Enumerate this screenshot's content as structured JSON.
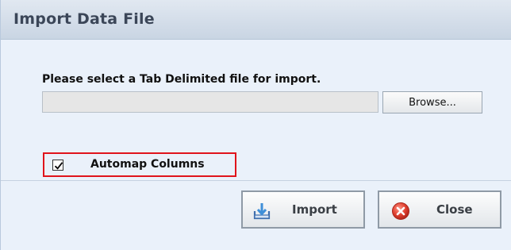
{
  "dialog": {
    "title": "Import Data File",
    "prompt": "Please select a Tab Delimited file for import.",
    "file_input": {
      "value": "",
      "placeholder": ""
    },
    "browse_label": "Browse...",
    "automap": {
      "label": "Automap Columns",
      "checked": true
    },
    "buttons": {
      "import_label": "Import",
      "close_label": "Close"
    },
    "icons": {
      "import": "import-download-icon",
      "close": "close-x-circle-icon"
    },
    "colors": {
      "title_bar": "#c9d5e3",
      "background": "#eaf1fa",
      "highlight_border": "#e0141b",
      "close_icon": "#e04030"
    }
  }
}
